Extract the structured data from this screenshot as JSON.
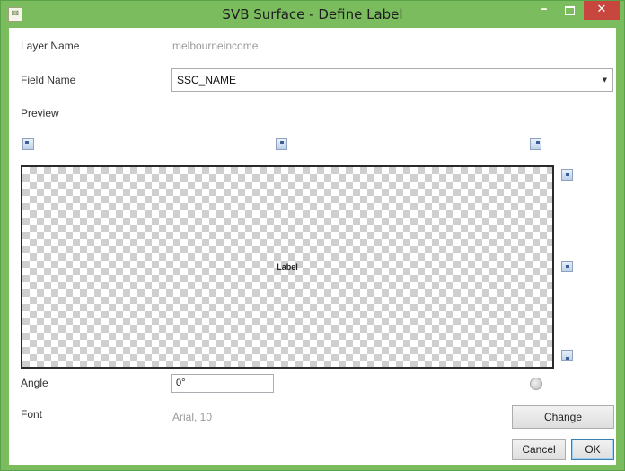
{
  "window": {
    "title": "SVB Surface - Define Label",
    "app_icon_glyph": "✉",
    "minimize_glyph": "–",
    "close_glyph": "✕"
  },
  "colors": {
    "titlebar": "#7bbd5e",
    "close_button": "#c7463d",
    "placeholder_text": "#9a9a9a"
  },
  "form": {
    "layer_name_label": "Layer Name",
    "layer_name_value": "melbourneincome",
    "field_name_label": "Field Name",
    "field_name_value": "SSC_NAME",
    "preview_label": "Preview",
    "preview_sample_text": "Label",
    "angle_label": "Angle",
    "angle_value": "0°",
    "font_label": "Font",
    "font_value": "Arial, 10"
  },
  "buttons": {
    "change": "Change",
    "cancel": "Cancel",
    "ok": "OK"
  },
  "icons": {
    "combo_arrow": "chevron-down-icon",
    "positions": [
      "align-top-left-icon",
      "align-top-center-icon",
      "align-top-right-icon",
      "align-middle-right-icon",
      "align-center-right-icon",
      "align-bottom-right-icon"
    ],
    "rotate": "rotate-icon"
  }
}
